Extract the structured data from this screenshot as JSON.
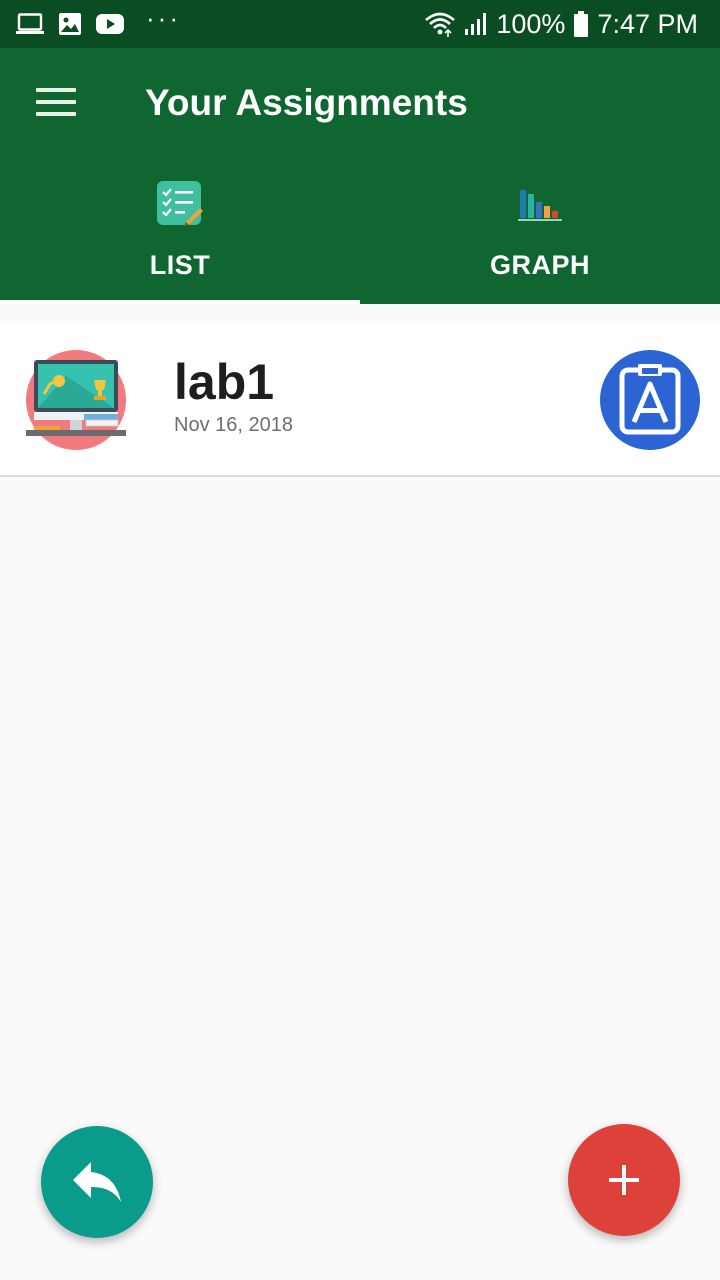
{
  "status_bar": {
    "battery": "100%",
    "time": "7:47 PM",
    "dots": "···",
    "icons": [
      "laptop-icon",
      "image-icon",
      "youtube-icon",
      "wifi-icon",
      "signal-icon",
      "battery-icon"
    ]
  },
  "app_bar": {
    "title": "Your Assignments",
    "menu_icon": "hamburger-menu-icon",
    "color": "#0f6630"
  },
  "tabs": [
    {
      "label": "LIST",
      "icon": "checklist-icon",
      "selected": true
    },
    {
      "label": "GRAPH",
      "icon": "bar-chart-icon",
      "selected": false
    }
  ],
  "assignments": [
    {
      "title": "lab1",
      "date": "Nov 16, 2018",
      "thumbnail_icon": "desk-computer-icon",
      "action_icon": "assignment-clipboard-icon"
    }
  ],
  "fabs": {
    "back": {
      "icon": "reply-arrow-icon",
      "color": "#0b9b8b"
    },
    "add": {
      "icon": "plus-icon",
      "color": "#de4139"
    }
  }
}
